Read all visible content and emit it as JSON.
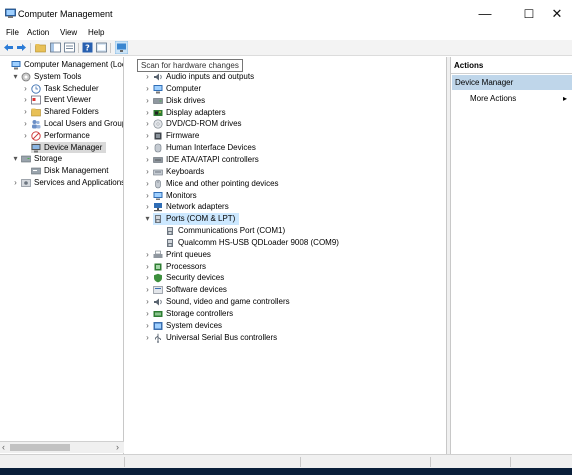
{
  "window": {
    "title": "Computer Management",
    "minimize_glyph": "—",
    "maximize_glyph": "☐",
    "close_glyph": "✕"
  },
  "menu": [
    "File",
    "Action",
    "View",
    "Help"
  ],
  "tooltip": "Scan for hardware changes",
  "left_tree": [
    {
      "label": "Computer Management (Local",
      "indent": 0,
      "expander": "",
      "icon": "computer-management-icon"
    },
    {
      "label": "System Tools",
      "indent": 1,
      "expander": "▾",
      "icon": "tools-icon"
    },
    {
      "label": "Task Scheduler",
      "indent": 2,
      "expander": "›",
      "icon": "clock-icon"
    },
    {
      "label": "Event Viewer",
      "indent": 2,
      "expander": "›",
      "icon": "event-viewer-icon"
    },
    {
      "label": "Shared Folders",
      "indent": 2,
      "expander": "›",
      "icon": "shared-folder-icon"
    },
    {
      "label": "Local Users and Groups",
      "indent": 2,
      "expander": "›",
      "icon": "users-icon"
    },
    {
      "label": "Performance",
      "indent": 2,
      "expander": "›",
      "icon": "performance-icon"
    },
    {
      "label": "Device Manager",
      "indent": 2,
      "expander": "",
      "icon": "device-manager-icon",
      "selected": true
    },
    {
      "label": "Storage",
      "indent": 1,
      "expander": "▾",
      "icon": "storage-icon"
    },
    {
      "label": "Disk Management",
      "indent": 2,
      "expander": "",
      "icon": "disk-icon"
    },
    {
      "label": "Services and Applications",
      "indent": 1,
      "expander": "›",
      "icon": "services-icon"
    }
  ],
  "device_tree": [
    {
      "label": "Audio inputs and outputs",
      "indent": 1,
      "expander": "›",
      "icon": "audio-icon"
    },
    {
      "label": "Computer",
      "indent": 1,
      "expander": "›",
      "icon": "computer-icon"
    },
    {
      "label": "Disk drives",
      "indent": 1,
      "expander": "›",
      "icon": "disk-drive-icon"
    },
    {
      "label": "Display adapters",
      "indent": 1,
      "expander": "›",
      "icon": "display-adapter-icon"
    },
    {
      "label": "DVD/CD-ROM drives",
      "indent": 1,
      "expander": "›",
      "icon": "dvd-icon"
    },
    {
      "label": "Firmware",
      "indent": 1,
      "expander": "›",
      "icon": "firmware-icon"
    },
    {
      "label": "Human Interface Devices",
      "indent": 1,
      "expander": "›",
      "icon": "hid-icon"
    },
    {
      "label": "IDE ATA/ATAPI controllers",
      "indent": 1,
      "expander": "›",
      "icon": "ide-icon"
    },
    {
      "label": "Keyboards",
      "indent": 1,
      "expander": "›",
      "icon": "keyboard-icon"
    },
    {
      "label": "Mice and other pointing devices",
      "indent": 1,
      "expander": "›",
      "icon": "mouse-icon"
    },
    {
      "label": "Monitors",
      "indent": 1,
      "expander": "›",
      "icon": "monitor-icon"
    },
    {
      "label": "Network adapters",
      "indent": 1,
      "expander": "›",
      "icon": "network-icon"
    },
    {
      "label": "Ports (COM & LPT)",
      "indent": 1,
      "expander": "▾",
      "icon": "port-icon",
      "selected": true
    },
    {
      "label": "Communications Port (COM1)",
      "indent": 2,
      "expander": "",
      "icon": "port-icon"
    },
    {
      "label": "Qualcomm HS-USB QDLoader 9008 (COM9)",
      "indent": 2,
      "expander": "",
      "icon": "port-icon"
    },
    {
      "label": "Print queues",
      "indent": 1,
      "expander": "›",
      "icon": "printer-icon"
    },
    {
      "label": "Processors",
      "indent": 1,
      "expander": "›",
      "icon": "processor-icon"
    },
    {
      "label": "Security devices",
      "indent": 1,
      "expander": "›",
      "icon": "security-icon"
    },
    {
      "label": "Software devices",
      "indent": 1,
      "expander": "›",
      "icon": "software-icon"
    },
    {
      "label": "Sound, video and game controllers",
      "indent": 1,
      "expander": "›",
      "icon": "sound-icon"
    },
    {
      "label": "Storage controllers",
      "indent": 1,
      "expander": "›",
      "icon": "storage-controller-icon"
    },
    {
      "label": "System devices",
      "indent": 1,
      "expander": "›",
      "icon": "system-devices-icon"
    },
    {
      "label": "Universal Serial Bus controllers",
      "indent": 1,
      "expander": "›",
      "icon": "usb-icon"
    }
  ],
  "actions": {
    "header": "Actions",
    "section": "Device Manager",
    "more": "More Actions",
    "more_arrow": "▸"
  },
  "scroll": {
    "left_arrow": "‹",
    "right_arrow": "›"
  },
  "colors": {
    "selection": "#cce8ff",
    "actions_section": "#bfd6ea"
  }
}
